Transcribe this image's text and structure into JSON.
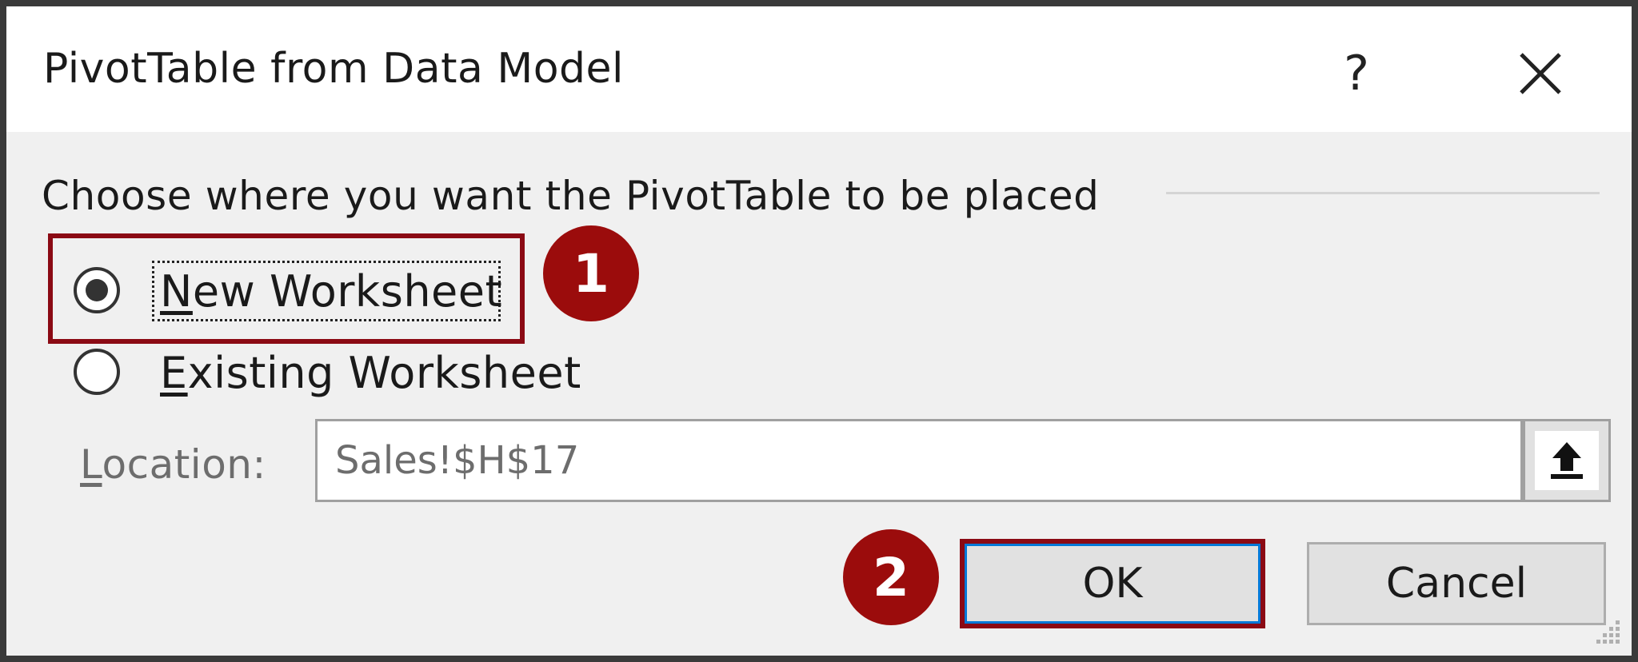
{
  "dialog": {
    "title": "PivotTable from Data Model",
    "help_label": "?",
    "close_icon": "close-icon"
  },
  "placement": {
    "group_label": "Choose where you want the PivotTable to be placed",
    "options": [
      {
        "label_first": "N",
        "label_rest": "ew Worksheet",
        "checked": true
      },
      {
        "label_first": "E",
        "label_rest": "xisting Worksheet",
        "checked": false
      }
    ]
  },
  "location": {
    "label_first": "L",
    "label_rest": "ocation:",
    "value": "Sales!$H$17",
    "collapse_icon": "collapse-dialog-icon"
  },
  "buttons": {
    "ok_label": "OK",
    "cancel_label": "Cancel"
  },
  "annotations": {
    "step1": "1",
    "step2": "2",
    "color": "#9b0c0c",
    "box_color": "#8b0a14"
  },
  "colors": {
    "focus_blue": "#0078d7",
    "dialog_bg": "#f0f0f0"
  }
}
